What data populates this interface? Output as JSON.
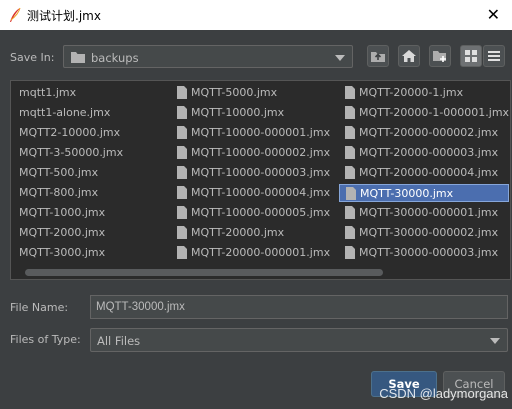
{
  "window": {
    "title": "测试计划.jmx"
  },
  "save_in": {
    "label": "Save In:",
    "value": "backups"
  },
  "files": [
    "mqtt1.jmx",
    "mqtt1-alone.jmx",
    "MQTT2-10000.jmx",
    "MQTT-3-50000.jmx",
    "MQTT-500.jmx",
    "MQTT-800.jmx",
    "MQTT-1000.jmx",
    "MQTT-2000.jmx",
    "MQTT-3000.jmx",
    "MQTT-5000.jmx",
    "MQTT-10000.jmx",
    "MQTT-10000-000001.jmx",
    "MQTT-10000-000002.jmx",
    "MQTT-10000-000003.jmx",
    "MQTT-10000-000004.jmx",
    "MQTT-10000-000005.jmx",
    "MQTT-20000.jmx",
    "MQTT-20000-000001.jmx",
    "MQTT-20000-1.jmx",
    "MQTT-20000-1-000001.jmx",
    "MQTT-20000-000002.jmx",
    "MQTT-20000-000003.jmx",
    "MQTT-20000-000004.jmx",
    "MQTT-30000.jmx",
    "MQTT-30000-000001.jmx",
    "MQTT-30000-000002.jmx",
    "MQTT-30000-000003.jmx"
  ],
  "selected_file": "MQTT-30000.jmx",
  "file_name": {
    "label": "File Name:",
    "value": "MQTT-30000.jmx"
  },
  "files_of_type": {
    "label": "Files of Type:",
    "value": "All Files"
  },
  "buttons": {
    "save": "Save",
    "cancel": "Cancel"
  },
  "watermark": "CSDN @ladymorgana",
  "colors": {
    "selection": "#4b6eaf",
    "background": "#3c3f41",
    "list_bg": "#2b2b2b"
  }
}
